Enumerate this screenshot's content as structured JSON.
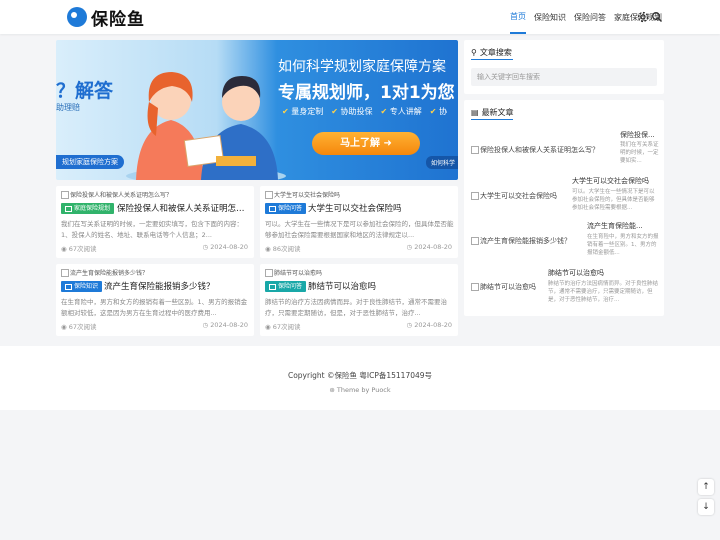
{
  "site": {
    "logo_text": "保险鱼"
  },
  "nav": {
    "items": [
      "首页",
      "保险知识",
      "保险问答",
      "家庭保险规划"
    ]
  },
  "banner": {
    "left_text": "？解答",
    "left_sub": "助理赔",
    "left_tag": "规划家庭保险方案",
    "title_line1": "如何科学规划家庭保障方案",
    "title_line2": "专属规划师，1对1为您",
    "features": [
      "量身定制",
      "协助投保",
      "专人讲解",
      "协"
    ],
    "button": "马上了解 ➜",
    "right_tag": "如何科学"
  },
  "posts": [
    {
      "img_alt": "保险投保人和被保人关系证明怎么写？",
      "category": "家庭保险规划",
      "title": "保险投保人和被保人关系证明怎么...",
      "excerpt": "我们在写关系证明的时候，一定要如实填写，包含下面的内容：1、投保人的姓名、地址、联系电话等个人信息；2...",
      "views": "67次阅读",
      "date": "2024-08-20"
    },
    {
      "img_alt": "大学生可以交社会保险吗",
      "category": "保险问答",
      "title": "大学生可以交社会保险吗",
      "excerpt": "可以。大学生在一些情况下是可以参加社会保险的，但具体是否能够参加社会保险需要根据国家和地区的法律规定以...",
      "views": "86次阅读",
      "date": "2024-08-20"
    },
    {
      "img_alt": "流产生育保险能报销多少钱？",
      "category": "保险知识",
      "title": "流产生育保险能报销多少钱？",
      "excerpt": "在生育险中，男方和女方的报销有着一些区别。1、男方的报销金额相对较低，这是因为男方在生育过程中的医疗费用...",
      "views": "67次阅读",
      "date": "2024-08-20"
    },
    {
      "img_alt": "肺结节可以治愈吗",
      "category": "保险问答",
      "title": "肺结节可以治愈吗",
      "excerpt": "肺结节的治疗方法因病情而异。对于良性肺结节，通常不需要治疗，只需要定期随访，但是，对于恶性肺结节，治疗...",
      "views": "67次阅读",
      "date": "2024-08-20"
    }
  ],
  "sidebar": {
    "search": {
      "title": "文章搜索",
      "placeholder": "输入关键字回车搜索"
    },
    "recent": {
      "title": "最新文章",
      "items": [
        {
          "img_alt": "保险投保人和被保人关系证明怎么写？",
          "title": "保险投保...",
          "excerpt": "我们在写关系证明的时候，一定要如实..."
        },
        {
          "img_alt": "大学生可以交社会保险吗",
          "title": "大学生可以交社会保险吗",
          "excerpt": "可以。大学生在一些情况下是可以参加社会保险的，但具体是否能够参加社会保险需要根据..."
        },
        {
          "img_alt": "流产生育保险能报销多少钱？",
          "title": "流产生育保险能...",
          "excerpt": "在生育险中，男方和女方的报销有着一些区别。1、男方的报销金额低..."
        },
        {
          "img_alt": "肺结节可以治愈吗",
          "title": "肺结节可以治愈吗",
          "excerpt": "肺结节的治疗方法因病情而异。对于良性肺结节，通常不需要治疗，只需要定期随访，但是，对于恶性肺结节，治疗..."
        }
      ]
    }
  },
  "footer": {
    "copyright": "Copyright ©保险鱼 粤ICP备15117049号",
    "theme": "Theme by Puock"
  },
  "colors": {
    "accent": "#1e7ad8",
    "green": "#31b36b",
    "teal": "#19a8a8",
    "button_orange": "#f5870c"
  }
}
